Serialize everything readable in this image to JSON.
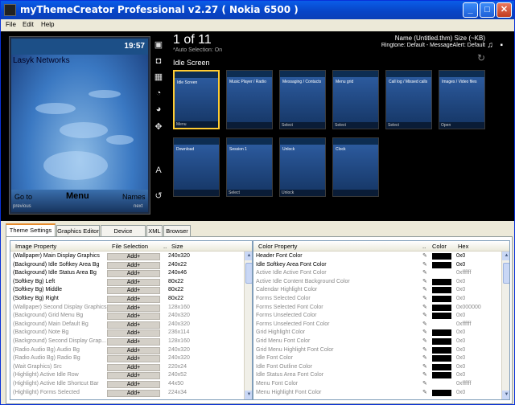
{
  "window": {
    "title": "myThemeCreator Professional v2.27 ( Nokia 6500 )",
    "buttons": [
      "_",
      "□",
      "✕"
    ]
  },
  "menu": [
    "File",
    "Edit",
    "Help"
  ],
  "phone": {
    "clock": "19:57",
    "operator": "Lasyk Networks",
    "left_soft": "Go to",
    "center_soft": "Menu",
    "right_soft": "Names",
    "left_sub": "previous",
    "right_sub": "next"
  },
  "gallery": {
    "counter": "1 of 11",
    "auto_selection": "*Auto Selection: On",
    "idle_label": "Idle Screen",
    "name_line": "Name (Untitled.thm) Size (~KB)",
    "ringtone_line": "Ringtone: Default - MessageAlert: Default",
    "thumbs": [
      {
        "label": "Idle Screen",
        "bottom": "Menu"
      },
      {
        "label": "Music Player / Radio",
        "bottom": ""
      },
      {
        "label": "Messaging / Contacts",
        "bottom": "Select"
      },
      {
        "label": "Menu grid",
        "bottom": "Select"
      },
      {
        "label": "Call log / Missed calls",
        "bottom": "Select"
      },
      {
        "label": "Images / Video files",
        "bottom": "Open"
      },
      {
        "label": "Download",
        "bottom": ""
      },
      {
        "label": "Session 1",
        "bottom": "Select"
      },
      {
        "label": "Unlock",
        "bottom": "Unlock"
      },
      {
        "label": "Clock",
        "bottom": ""
      }
    ]
  },
  "tabs": [
    "Theme Settings",
    "Graphics Editor",
    "Device Selection",
    "XML",
    "Browser"
  ],
  "image_grid": {
    "headers": [
      "Image Property",
      "File Selection",
      "..",
      "Size"
    ],
    "add_label": "Add+",
    "rows": [
      {
        "name": "(Wallpaper) Main Display Graphics",
        "size": "240x320",
        "dim": false
      },
      {
        "name": "(Background) Idle Softkey Area Bg",
        "size": "240x22",
        "dim": false
      },
      {
        "name": "(Background) Idle Status Area Bg",
        "size": "240x46",
        "dim": false
      },
      {
        "name": "(Softkey Bg) Left",
        "size": "80x22",
        "dim": false
      },
      {
        "name": "(Softkey Bg) Middle",
        "size": "80x22",
        "dim": false
      },
      {
        "name": "(Softkey Bg) Right",
        "size": "80x22",
        "dim": false
      },
      {
        "name": "(Wallpaper) Second Display Graphics",
        "size": "128x160",
        "dim": true
      },
      {
        "name": "(Background) Grid Menu Bg",
        "size": "240x320",
        "dim": true
      },
      {
        "name": "(Background) Main Default Bg",
        "size": "240x320",
        "dim": true
      },
      {
        "name": "(Background) Note Bg",
        "size": "236x114",
        "dim": true
      },
      {
        "name": "(Background) Second Display Grap...",
        "size": "128x160",
        "dim": true
      },
      {
        "name": "(Radio Audio Bg) Audio Bg",
        "size": "240x320",
        "dim": true
      },
      {
        "name": "(Radio Audio Bg) Radio Bg",
        "size": "240x320",
        "dim": true
      },
      {
        "name": "(Wait Graphics) Src",
        "size": "220x24",
        "dim": true
      },
      {
        "name": "(Highlight) Active Idle Row",
        "size": "240x52",
        "dim": true
      },
      {
        "name": "(Highlight) Active Idle Shortcut Bar",
        "size": "44x50",
        "dim": true
      },
      {
        "name": "(Highlight) Forms Selected",
        "size": "224x34",
        "dim": true
      }
    ]
  },
  "color_grid": {
    "headers": [
      "Color Property",
      "..",
      "Color",
      "Hex"
    ],
    "rows": [
      {
        "name": "Header Font Color",
        "hex": "0x0",
        "dim": false,
        "swatch": true
      },
      {
        "name": "Idle Softkey Area Font Color",
        "hex": "0x0",
        "dim": false,
        "swatch": true
      },
      {
        "name": "Active Idle Active Font Color",
        "hex": "0xffffff",
        "dim": true,
        "swatch": false
      },
      {
        "name": "Active Idle Content Background Color",
        "hex": "0x0",
        "dim": true,
        "swatch": true
      },
      {
        "name": "Calendar Highlight Color",
        "hex": "0x0",
        "dim": true,
        "swatch": true
      },
      {
        "name": "Forms Selected Color",
        "hex": "0x0",
        "dim": true,
        "swatch": true
      },
      {
        "name": "Forms Selected Font Color",
        "hex": "0x000000",
        "dim": true,
        "swatch": true
      },
      {
        "name": "Forms Unselected Color",
        "hex": "0x0",
        "dim": true,
        "swatch": true
      },
      {
        "name": "Forms Unselected Font Color",
        "hex": "0xffffff",
        "dim": true,
        "swatch": false
      },
      {
        "name": "Grid Highlight Color",
        "hex": "0x0",
        "dim": true,
        "swatch": true
      },
      {
        "name": "Grid Menu Font Color",
        "hex": "0x0",
        "dim": true,
        "swatch": true
      },
      {
        "name": "Grid Menu Highlight Font Color",
        "hex": "0x0",
        "dim": true,
        "swatch": true
      },
      {
        "name": "Idle Font Color",
        "hex": "0x0",
        "dim": true,
        "swatch": true
      },
      {
        "name": "Idle Font Outline Color",
        "hex": "0x0",
        "dim": true,
        "swatch": true
      },
      {
        "name": "Idle Status Area Font Color",
        "hex": "0x0",
        "dim": true,
        "swatch": true
      },
      {
        "name": "Menu Font Color",
        "hex": "0xffffff",
        "dim": true,
        "swatch": false
      },
      {
        "name": "Menu Highlight Font Color",
        "hex": "0x0",
        "dim": true,
        "swatch": true
      }
    ]
  }
}
